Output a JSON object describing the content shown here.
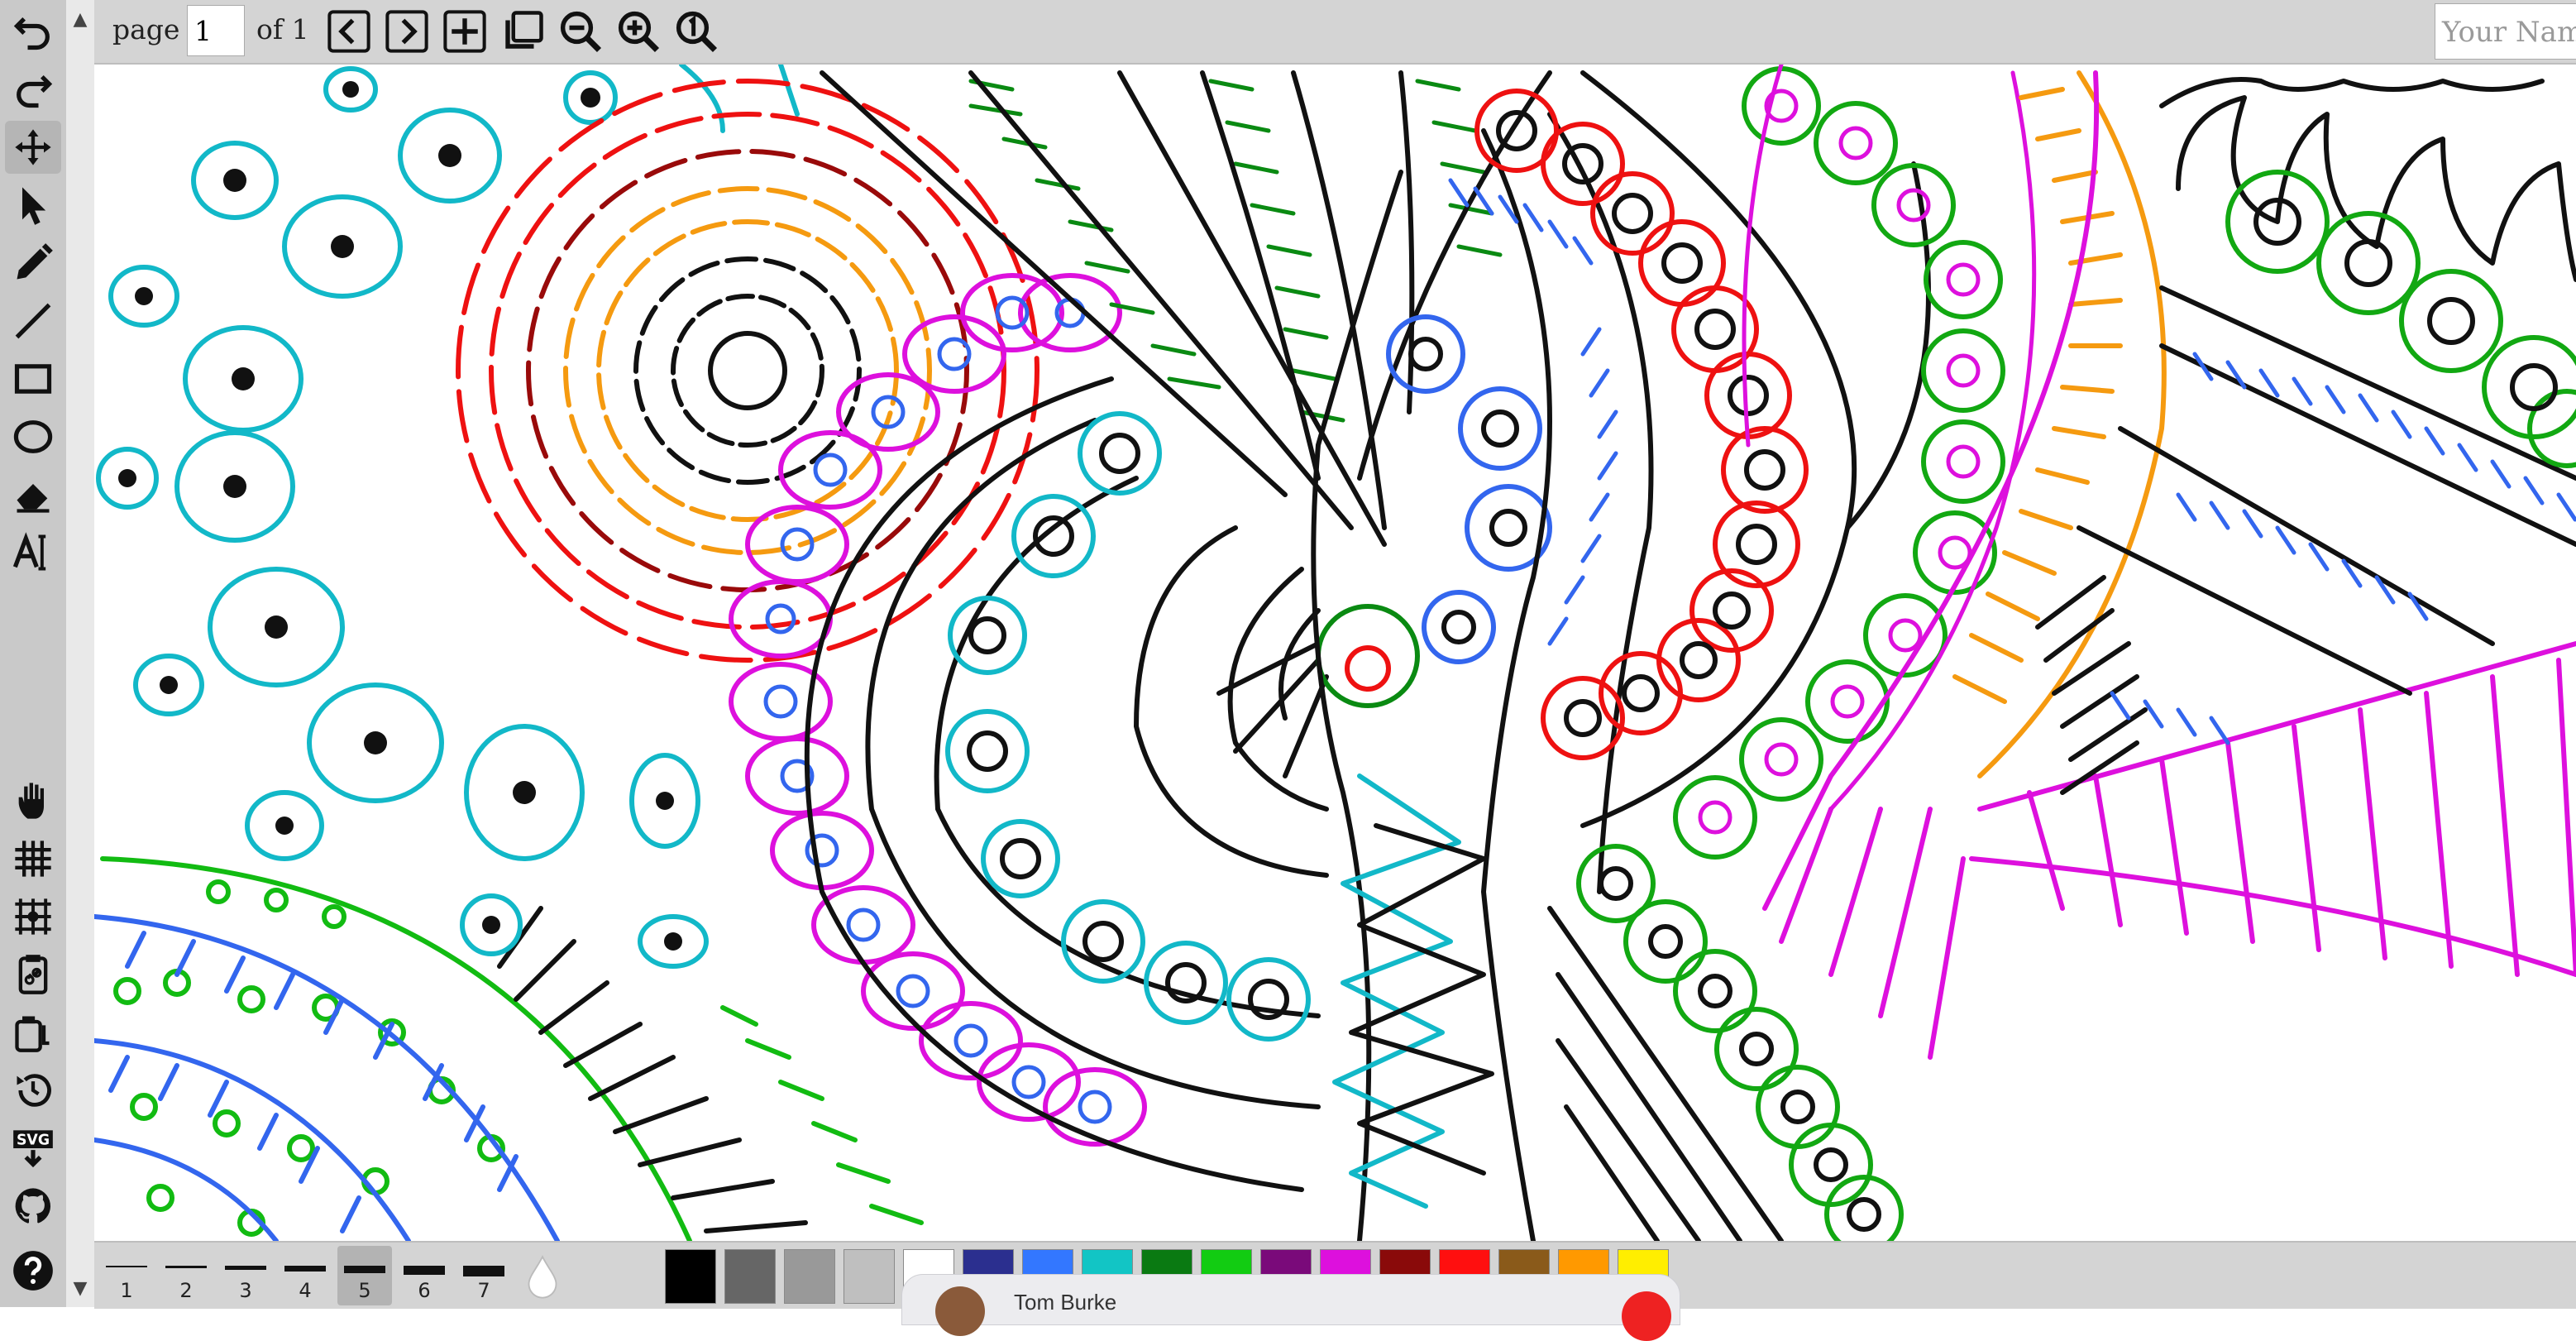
{
  "toolbar_top": {
    "page_label": "page",
    "page_value": "1",
    "of_label": "of 1",
    "name_placeholder": "Your Name"
  },
  "left_tools": [
    "undo-icon",
    "redo-icon",
    "move-icon",
    "select-icon",
    "pencil-icon",
    "line-icon",
    "rectangle-icon",
    "ellipse-icon",
    "eraser-icon",
    "text-icon",
    "pan-icon",
    "grid-icon",
    "snap-grid-icon",
    "share-link-icon",
    "clipboard-copy-icon",
    "history-icon",
    "svg-export-icon",
    "github-icon",
    "help-icon"
  ],
  "palette": {
    "widths": [
      "1",
      "2",
      "3",
      "4",
      "5",
      "6",
      "7"
    ],
    "active_width": "5",
    "colors": [
      "#000000",
      "#666666",
      "#999999",
      "#bfbfbf",
      "#ffffff",
      "#2b2f8f",
      "#3377ff",
      "#12c5c5",
      "#0a7a12",
      "#12cc12",
      "#7a0a7a",
      "#dd10dd",
      "#8a0a0a",
      "#ff0f0f",
      "#8a5a1a",
      "#ff9900",
      "#ffee00"
    ]
  },
  "taskbar": {
    "user_name": "Tom Burke"
  }
}
